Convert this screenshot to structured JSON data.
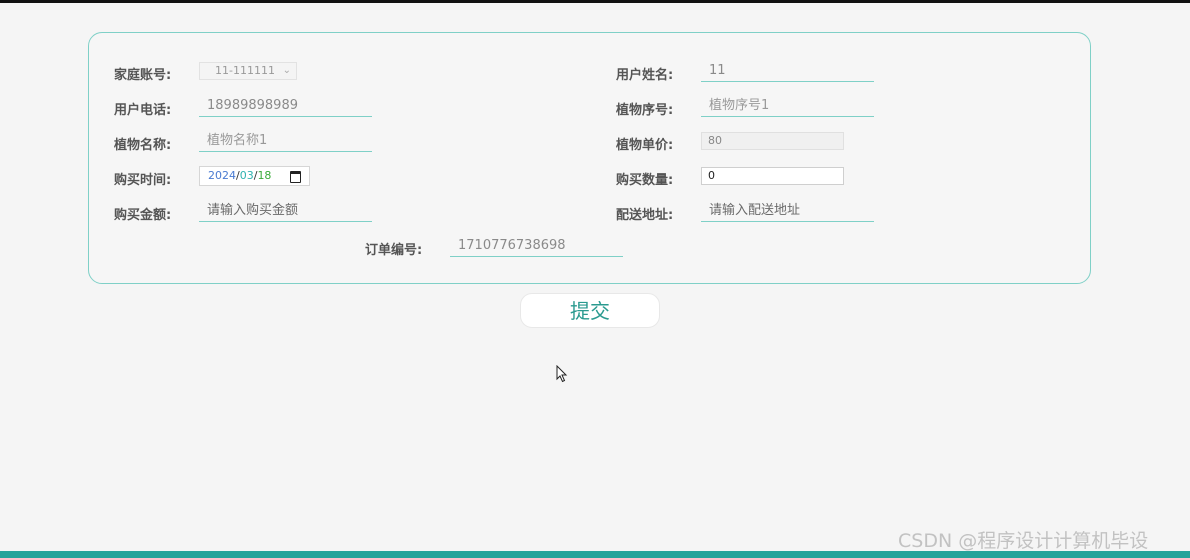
{
  "form": {
    "family_account": {
      "label": "家庭账号:",
      "value": "11-111111"
    },
    "user_name": {
      "label": "用户姓名:",
      "value": "11"
    },
    "user_phone": {
      "label": "用户电话:",
      "value": "18989898989"
    },
    "plant_serial": {
      "label": "植物序号:",
      "placeholder": "植物序号1"
    },
    "plant_name": {
      "label": "植物名称:",
      "placeholder": "植物名称1"
    },
    "plant_price": {
      "label": "植物单价:",
      "value": "80"
    },
    "purchase_time": {
      "label": "购买时间:",
      "year": "2024",
      "month": "03",
      "day": "18",
      "separator": "/"
    },
    "purchase_quantity": {
      "label": "购买数量:",
      "value": "0"
    },
    "purchase_amount": {
      "label": "购买金额:",
      "placeholder": "请输入购买金额"
    },
    "delivery_address": {
      "label": "配送地址:",
      "placeholder": "请输入配送地址"
    },
    "order_number": {
      "label": "订单编号:",
      "value": "1710776738698"
    }
  },
  "submit_label": "提交",
  "watermark": "CSDN @程序设计计算机毕设",
  "colors": {
    "accent": "#27a39a",
    "border": "#7fd0c7",
    "submit_text": "#2a9a8f"
  }
}
